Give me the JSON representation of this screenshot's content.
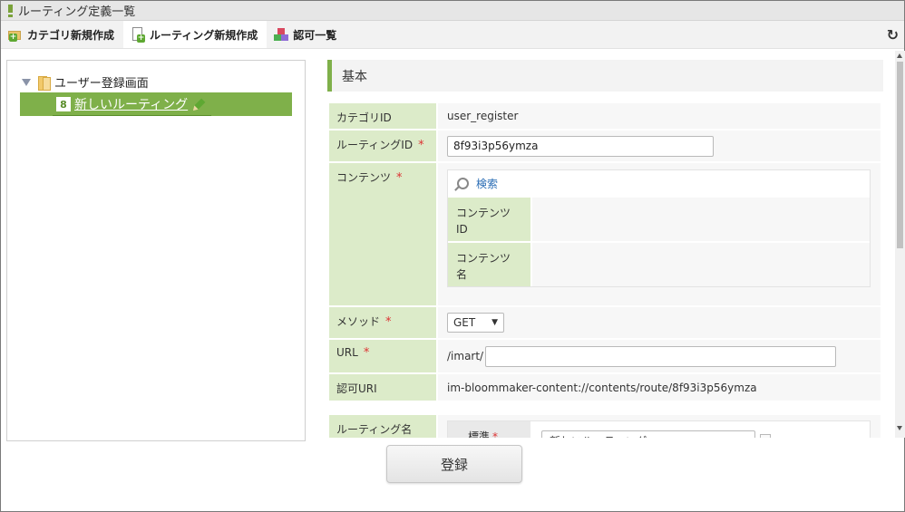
{
  "window": {
    "title": "ルーティング定義一覧"
  },
  "toolbar": {
    "items": [
      {
        "label": "カテゴリ新規作成",
        "icon": "folder-add-icon"
      },
      {
        "label": "ルーティング新規作成",
        "icon": "page-add-icon"
      },
      {
        "label": "認可一覧",
        "icon": "blocks-icon"
      }
    ],
    "refresh_icon": "↻"
  },
  "tree": {
    "root": {
      "label": "ユーザー登録画面"
    },
    "child": {
      "badge": "8",
      "label": "新しいルーティング"
    }
  },
  "form": {
    "section_title": "基本",
    "fields": {
      "category_id": {
        "label": "カテゴリID",
        "value": "user_register"
      },
      "routing_id": {
        "label": "ルーティングID",
        "required": "*",
        "value": "8f93i3p56ymza"
      },
      "contents": {
        "label": "コンテンツ",
        "required": "*",
        "search_label": "検索",
        "content_id_label": "コンテンツ\nID",
        "content_name_label": "コンテンツ\n名"
      },
      "method": {
        "label": "メソッド",
        "required": "*",
        "value": "GET"
      },
      "url": {
        "label": "URL",
        "required": "*",
        "prefix": "/imart/",
        "value": ""
      },
      "auth_uri": {
        "label": "認可URI",
        "value": "im-bloommaker-content://contents/route/8f93i3p56ymza"
      },
      "routing_name": {
        "label": "ルーティング名",
        "locale_label": "標準",
        "required": "*",
        "value": "新しいルーティング"
      }
    },
    "submit_label": "登録"
  },
  "colors": {
    "accent_green": "#7fb04a",
    "label_bg": "#dcebc9",
    "required_red": "#d33333",
    "link_blue": "#2a6db5"
  }
}
